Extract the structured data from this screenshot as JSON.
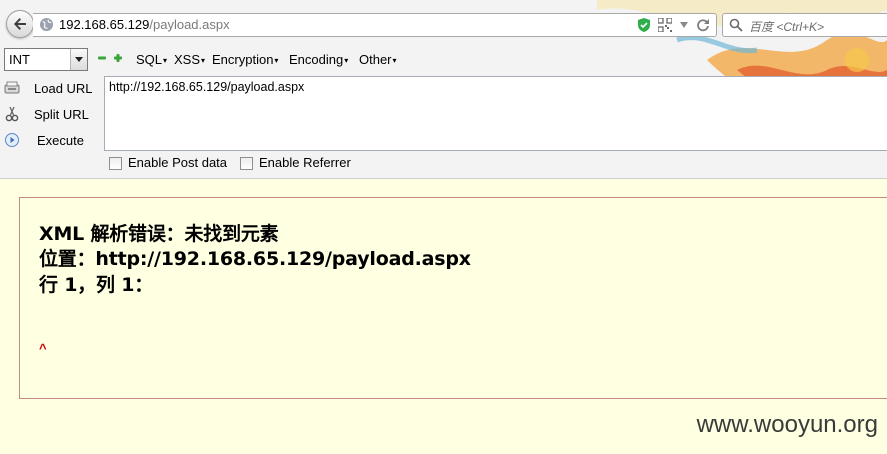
{
  "browser": {
    "url_host": "192.168.65.129",
    "url_path": "/payload.aspx",
    "search_placeholder": "百度 <Ctrl+K>"
  },
  "hackbar": {
    "select_value": "INT",
    "menus": [
      "SQL",
      "XSS",
      "Encryption",
      "Encoding",
      "Other"
    ],
    "actions": {
      "load_url": "Load URL",
      "split_url": "Split URL",
      "execute": "Execute"
    },
    "url_value": "http://192.168.65.129/payload.aspx",
    "enable_post": "Enable Post data",
    "enable_referrer": "Enable Referrer"
  },
  "error": {
    "line1": "XML 解析错误：未找到元素",
    "line2": "位置：http://192.168.65.129/payload.aspx",
    "line3": "行 1，列 1：",
    "caret": "^"
  },
  "watermark": "www.wooyun.org",
  "colors": {
    "page_bg": "#ffffe1",
    "error_border": "#c48a8a",
    "caret": "#cc0000",
    "toolbar_bg": "#f3f3f3"
  }
}
